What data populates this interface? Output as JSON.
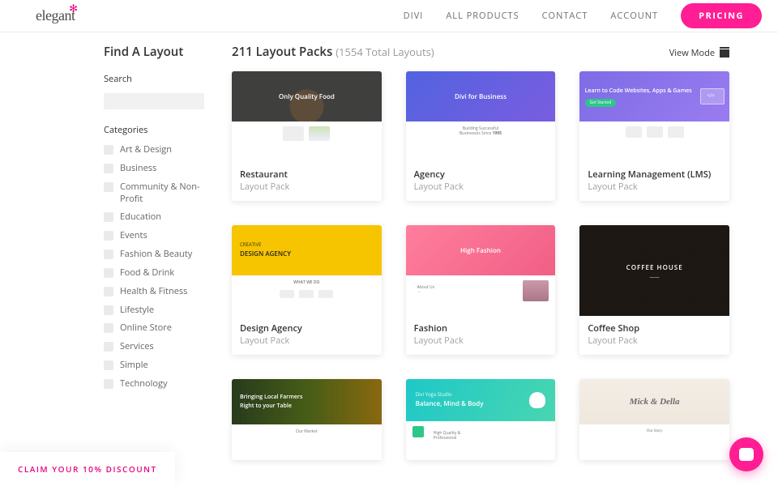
{
  "header": {
    "logo_text": "elegant",
    "nav": {
      "divi": "DIVI",
      "all_products": "ALL PRODUCTS",
      "contact": "CONTACT",
      "account": "ACCOUNT",
      "pricing": "PRICING"
    }
  },
  "sidebar": {
    "title": "Find A Layout",
    "search_label": "Search",
    "search_placeholder": "",
    "categories_label": "Categories",
    "categories": [
      "Art & Design",
      "Business",
      "Community & Non-Profit",
      "Education",
      "Events",
      "Fashion & Beauty",
      "Food & Drink",
      "Health & Fitness",
      "Lifestyle",
      "Online Store",
      "Services",
      "Simple",
      "Technology"
    ]
  },
  "main": {
    "count": "211",
    "count_suffix": " Layout Packs ",
    "total": "(1554 Total Layouts)",
    "view_mode_label": "View Mode",
    "card_sub": "Layout Pack",
    "cards": [
      {
        "title": "Restaurant",
        "hero_line1": "",
        "hero_line2": "Only Quality Food"
      },
      {
        "title": "Agency",
        "hero_line1": "",
        "hero_line2": "Divi for Business"
      },
      {
        "title": "Learning Management (LMS)",
        "hero_line1": "Learn to Code Websites, Apps & Games",
        "hero_line2": ""
      },
      {
        "title": "Design Agency",
        "hero_line1": "CREATIVE",
        "hero_line2": "DESIGN AGENCY"
      },
      {
        "title": "Fashion",
        "hero_line1": "",
        "hero_line2": "High Fashion"
      },
      {
        "title": "Coffee Shop",
        "hero_line1": "",
        "hero_line2": "COFFEE HOUSE"
      },
      {
        "title": "",
        "hero_line1": "Bringing Local Farmers",
        "hero_line2": "Right to your Table"
      },
      {
        "title": "",
        "hero_line1": "Divi Yoga Studio",
        "hero_line2": "Balance, Mind & Body"
      },
      {
        "title": "",
        "hero_line1": "",
        "hero_line2": "Mick & Della"
      }
    ]
  },
  "discount_banner": "CLAIM YOUR 10% DISCOUNT",
  "colors": {
    "accent": "#ff1e93",
    "brand_pink": "#e6007e"
  }
}
